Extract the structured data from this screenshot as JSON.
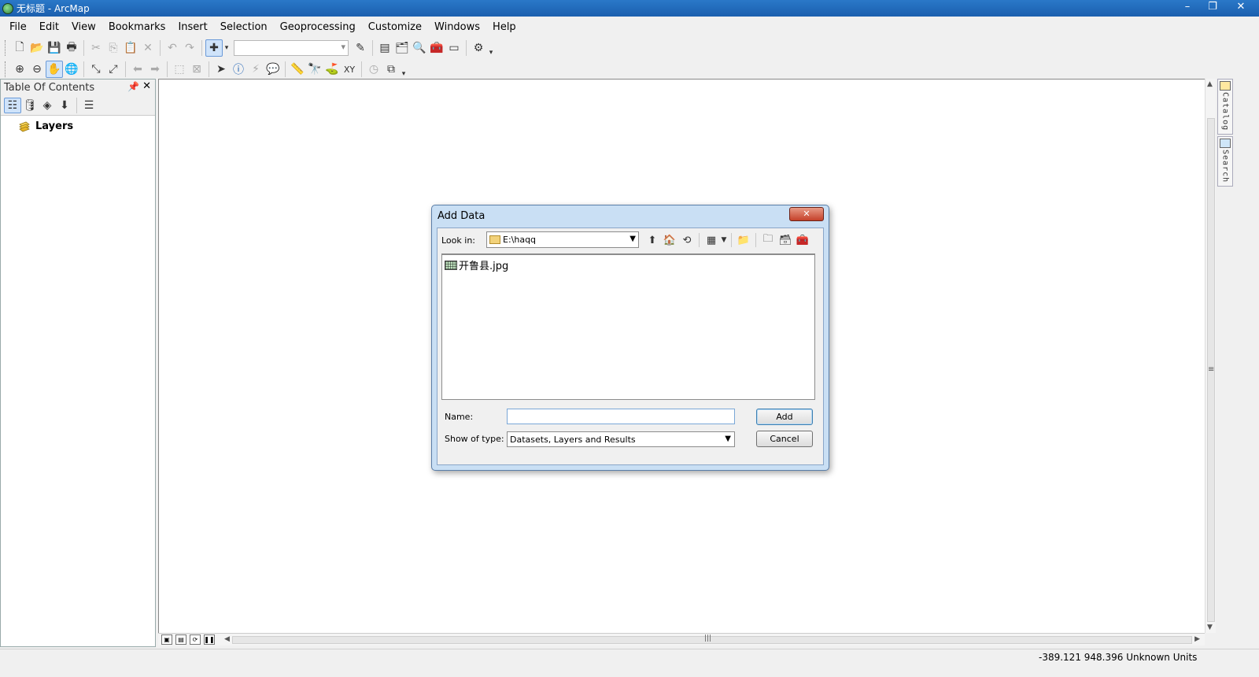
{
  "window": {
    "title": "无标题 - ArcMap",
    "controls": {
      "minimize": "–",
      "maximize": "❐",
      "close": "✕"
    }
  },
  "menubar": {
    "items": [
      "File",
      "Edit",
      "View",
      "Bookmarks",
      "Insert",
      "Selection",
      "Geoprocessing",
      "Customize",
      "Windows",
      "Help"
    ]
  },
  "toc": {
    "title": "Table Of Contents",
    "root_label": "Layers"
  },
  "dialog": {
    "title": "Add Data",
    "close_glyph": "✕",
    "look_in_label": "Look in:",
    "look_in_value": "E:\\haqq",
    "files": [
      "开鲁县.jpg"
    ],
    "name_label": "Name:",
    "name_value": "",
    "show_type_label": "Show of type:",
    "show_type_value": "Datasets, Layers and Results",
    "add_label": "Add",
    "cancel_label": "Cancel"
  },
  "right_dock": {
    "tabs": [
      "Catalog",
      "Search"
    ]
  },
  "statusbar": {
    "coordinates": "-389.121  948.396 Unknown Units"
  },
  "icons": {
    "new": "new-document-icon",
    "open": "open-folder-icon",
    "save": "save-icon",
    "print": "print-icon",
    "add_data": "add-data-icon",
    "zoom_in": "zoom-in-icon",
    "pan": "pan-hand-icon",
    "identify": "identify-icon"
  }
}
